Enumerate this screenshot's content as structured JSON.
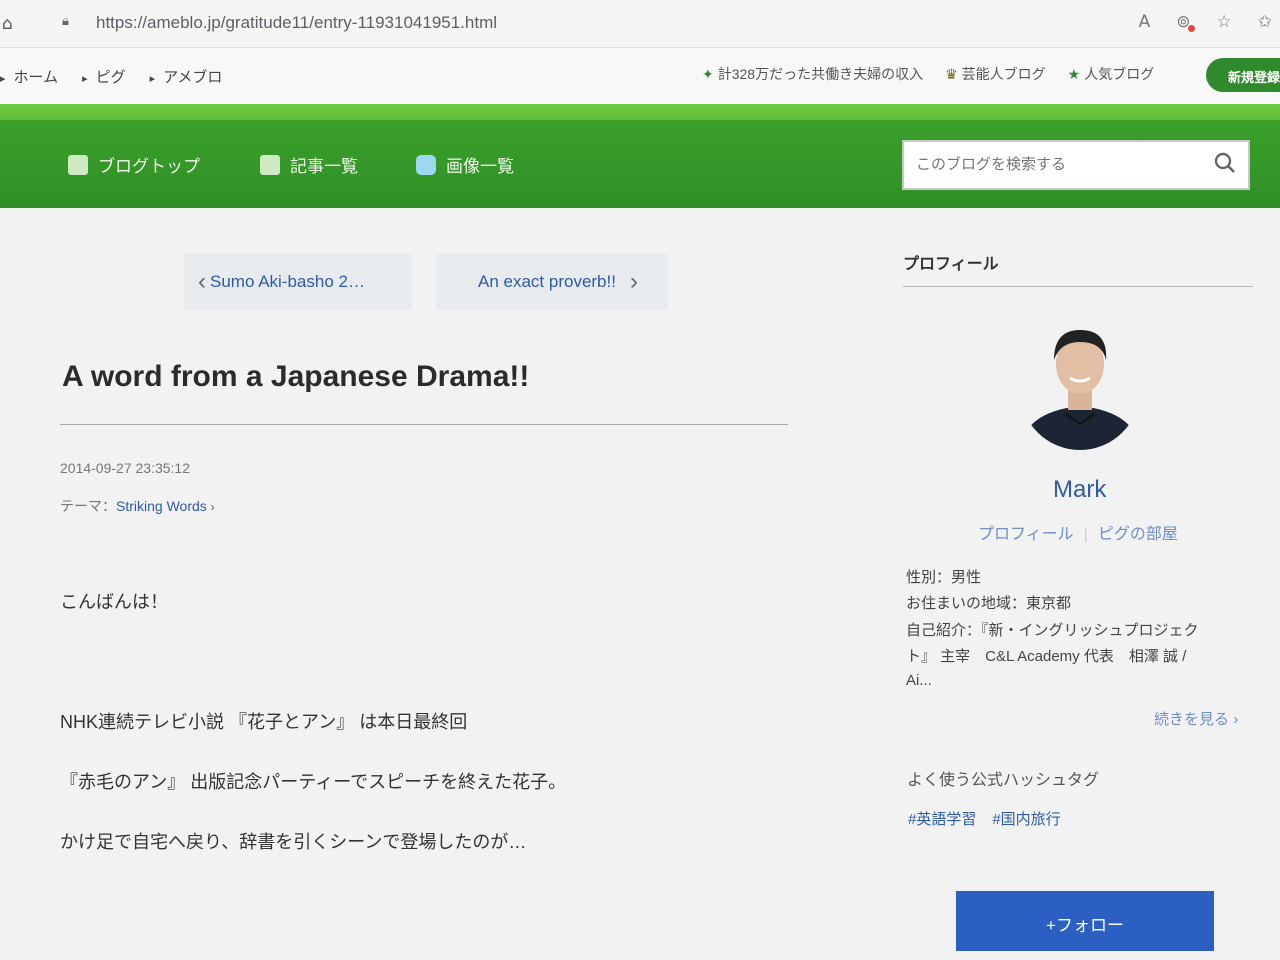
{
  "browser": {
    "url": "https://ameblo.jp/gratitude11/entry-11931041951.html",
    "icons": [
      "home-icon",
      "lock-icon",
      "read-aloud-icon",
      "extension-icon",
      "favorite-icon",
      "collections-icon"
    ]
  },
  "ameba_nav": {
    "breadcrumbs": [
      "ホーム",
      "ピグ",
      "アメブロ"
    ],
    "promos": [
      "計328万だった共働き夫婦の収入",
      "芸能人ブログ",
      "人気ブログ"
    ],
    "register_label": "新規登録"
  },
  "blog_header": {
    "nav": [
      {
        "label": "ブログトップ",
        "icon": "document-icon"
      },
      {
        "label": "記事一覧",
        "icon": "copy-icon"
      },
      {
        "label": "画像一覧",
        "icon": "camera-icon"
      }
    ],
    "search_placeholder": "このブログを検索する"
  },
  "pager": {
    "prev": "Sumo Aki-basho 2…",
    "next": "An exact proverb!!"
  },
  "post": {
    "title": "A word from a Japanese Drama!!",
    "date": "2014-09-27 23:35:12",
    "theme_label": "テーマ：",
    "theme": "Striking Words",
    "lines": [
      "こんばんは！",
      "NHK連続テレビ小説 『花子とアン』 は本日最終回",
      "『赤毛のアン』 出版記念パーティーでスピーチを終えた花子。",
      "かけ足で自宅へ戻り、辞書を引くシーンで登場したのが…"
    ]
  },
  "sidebar": {
    "heading": "プロフィール",
    "name": "Mark",
    "links": [
      "プロフィール",
      "ピグの部屋"
    ],
    "info": [
      "性別：男性",
      "お住まいの地域：東京都",
      "自己紹介：『新・イングリッシュプロジェク",
      "ト』 主宰　C&L Academy 代表　相澤 誠 /",
      "Ai..."
    ],
    "more": "続きを見る",
    "hashtag_heading": "よく使う公式ハッシュタグ",
    "hashtags": [
      "#英語学習",
      "#国内旅行"
    ],
    "follow_label": "+フォロー"
  }
}
